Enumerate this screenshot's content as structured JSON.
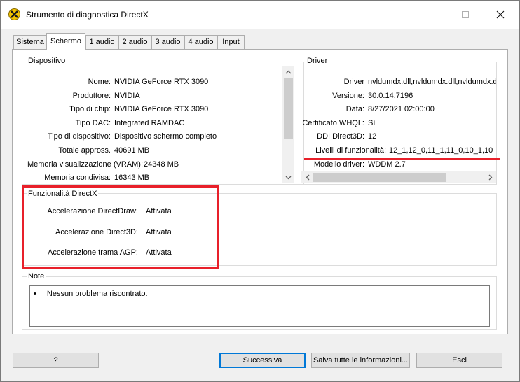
{
  "window": {
    "title": "Strumento di diagnostica DirectX",
    "accent_color": "#e8202a"
  },
  "tabs": [
    {
      "label": "Sistema"
    },
    {
      "label": "Schermo"
    },
    {
      "label": "1 audio"
    },
    {
      "label": "2 audio"
    },
    {
      "label": "3 audio"
    },
    {
      "label": "4 audio"
    },
    {
      "label": "Input"
    }
  ],
  "device": {
    "title": "Dispositivo",
    "rows": [
      {
        "label": "Nome:",
        "value": "NVIDIA GeForce RTX 3090"
      },
      {
        "label": "Produttore:",
        "value": "NVIDIA"
      },
      {
        "label": "Tipo di chip:",
        "value": "NVIDIA GeForce RTX 3090"
      },
      {
        "label": "Tipo DAC:",
        "value": "Integrated RAMDAC"
      },
      {
        "label": "Tipo di dispositivo:",
        "value": "Dispositivo schermo completo"
      },
      {
        "label": "Totale appross.",
        "value": "40691 MB"
      },
      {
        "label": "Memoria visualizzazione (VRAM):",
        "value": "24348 MB"
      },
      {
        "label": "Memoria condivisa:",
        "value": "16343 MB"
      }
    ]
  },
  "driver": {
    "title": "Driver",
    "rows": [
      {
        "label": "Driver",
        "value": "nvldumdx.dll,nvldumdx.dll,nvldumdx.d"
      },
      {
        "label": "Versione:",
        "value": "30.0.14.7196"
      },
      {
        "label": "Data:",
        "value": "8/27/2021 02:00:00"
      },
      {
        "label": "Certificato WHQL:",
        "value": "Sì"
      },
      {
        "label": "DDI Direct3D:",
        "value": "12"
      },
      {
        "label": "Livelli di funzionalità:",
        "value": "12_1,12_0,11_1,11_0,10_1,10"
      },
      {
        "label": "Modello driver:",
        "value": "WDDM 2.7"
      }
    ]
  },
  "directx_features": {
    "title": "Funzionalità DirectX",
    "rows": [
      {
        "label": "Accelerazione DirectDraw:",
        "value": "Attivata"
      },
      {
        "label": "Accelerazione Direct3D:",
        "value": "Attivata"
      },
      {
        "label": "Accelerazione trama AGP:",
        "value": "Attivata"
      }
    ]
  },
  "notes": {
    "title": "Note",
    "items": [
      "Nessun problema riscontrato."
    ]
  },
  "buttons": {
    "help": "?",
    "next": "Successiva",
    "save_all": "Salva tutte le informazioni...",
    "exit": "Esci"
  }
}
